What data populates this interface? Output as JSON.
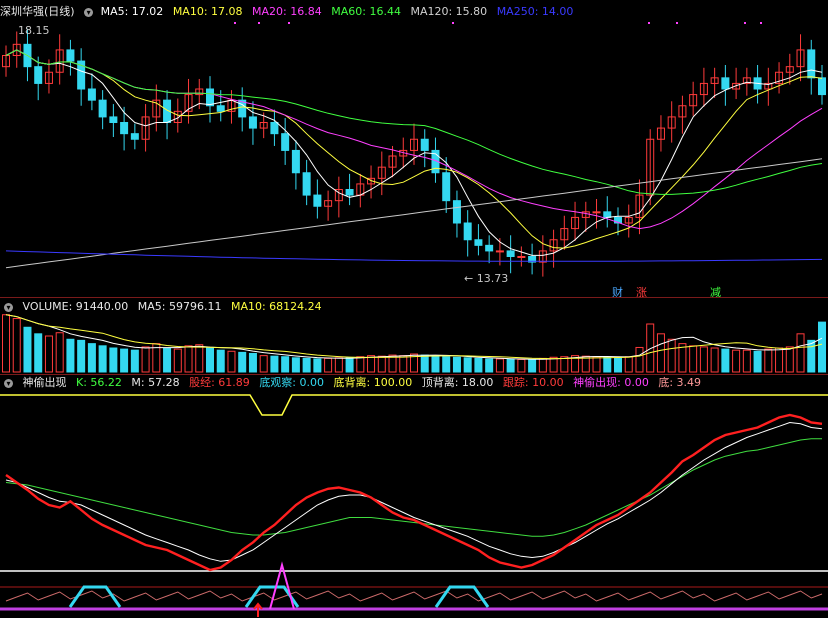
{
  "main_header": {
    "stock_title": "深圳华强(日线)",
    "ma5": "MA5: 17.02",
    "ma10": "MA10: 17.08",
    "ma20": "MA20: 16.84",
    "ma60": "MA60: 16.44",
    "ma120": "MA120: 15.80",
    "ma250": "MA250: 14.00"
  },
  "price_annotations": {
    "high_label": "18.15",
    "low_label": "13.73",
    "signal_cai": "财",
    "signal_zhang": "涨",
    "signal_jian": "减"
  },
  "volume_header": {
    "volume": "VOLUME: 91440.00",
    "ma5": "MA5: 59796.11",
    "ma10": "MA10: 68124.24"
  },
  "indicator_header": {
    "name": "神偷出现",
    "k": "K: 56.22",
    "m": "M: 57.28",
    "gujing": "股经: 61.89",
    "diguancha": "底观察: 0.00",
    "dibeili": "底背离: 100.00",
    "dingbeili": "顶背离: 18.00",
    "genzong": "跟踪: 10.00",
    "shentou": "神偷出现: 0.00",
    "di": "底: 3.49"
  },
  "colors": {
    "up": "#ff3b3b",
    "down": "#34d8f0",
    "ma5": "#ffffff",
    "ma10": "#ffff40",
    "ma20": "#ff40ff",
    "ma60": "#40ff40",
    "ma120": "#c8c8c8",
    "ma250": "#3a3aff"
  },
  "chart_data": {
    "type": "candlestick",
    "series": [
      {
        "name": "MA5",
        "last": 17.02
      },
      {
        "name": "MA10",
        "last": 17.08
      },
      {
        "name": "MA20",
        "last": 16.84
      },
      {
        "name": "MA60",
        "last": 16.44
      },
      {
        "name": "MA120",
        "last": 15.8
      },
      {
        "name": "MA250",
        "last": 14.0
      }
    ],
    "price_high": 18.15,
    "price_low": 13.73,
    "close": [
      17.7,
      17.9,
      17.5,
      17.2,
      17.4,
      17.8,
      17.6,
      17.1,
      16.9,
      16.6,
      16.5,
      16.3,
      16.2,
      16.6,
      16.9,
      16.5,
      16.7,
      17.0,
      17.1,
      16.8,
      16.7,
      16.9,
      16.6,
      16.4,
      16.5,
      16.3,
      16.0,
      15.6,
      15.2,
      15.0,
      15.1,
      15.3,
      15.2,
      15.4,
      15.5,
      15.7,
      15.9,
      16.0,
      16.2,
      16.0,
      15.6,
      15.1,
      14.7,
      14.4,
      14.3,
      14.2,
      14.2,
      14.1,
      14.1,
      14.0,
      14.2,
      14.4,
      14.6,
      14.8,
      14.9,
      14.9,
      14.8,
      14.7,
      14.8,
      15.2,
      16.2,
      16.4,
      16.6,
      16.8,
      17.0,
      17.2,
      17.3,
      17.1,
      17.2,
      17.3,
      17.1,
      17.2,
      17.4,
      17.5,
      17.8,
      17.3,
      17.0
    ],
    "volume": [
      105000,
      98000,
      82000,
      70000,
      66000,
      72000,
      60000,
      58000,
      52000,
      48000,
      44000,
      42000,
      40000,
      46000,
      52000,
      44000,
      42000,
      48000,
      50000,
      44000,
      40000,
      38000,
      36000,
      34000,
      30000,
      29000,
      28000,
      26000,
      25000,
      24000,
      25000,
      26000,
      26000,
      28000,
      30000,
      29000,
      31000,
      30000,
      33000,
      31000,
      30000,
      28000,
      27000,
      26000,
      25000,
      24000,
      24000,
      23000,
      23000,
      22000,
      25000,
      27000,
      28000,
      30000,
      29000,
      28000,
      27000,
      26000,
      28000,
      45000,
      88000,
      70000,
      60000,
      52000,
      48000,
      46000,
      44000,
      42000,
      40000,
      40000,
      38000,
      42000,
      44000,
      46000,
      70000,
      58000,
      91440
    ],
    "k_line": [
      84,
      78,
      72,
      65,
      60,
      58,
      63,
      56,
      49,
      44,
      40,
      36,
      32,
      28,
      26,
      24,
      20,
      16,
      12,
      8,
      10,
      16,
      24,
      30,
      38,
      44,
      52,
      60,
      66,
      70,
      73,
      74,
      72,
      70,
      66,
      60,
      54,
      50,
      48,
      44,
      40,
      36,
      32,
      28,
      24,
      18,
      14,
      12,
      10,
      12,
      16,
      20,
      26,
      32,
      38,
      44,
      48,
      52,
      58,
      64,
      70,
      78,
      86,
      95,
      100,
      106,
      112,
      116,
      118,
      120,
      122,
      126,
      130,
      132,
      130,
      126,
      125
    ],
    "m_line": [
      80,
      78,
      74,
      70,
      66,
      63,
      62,
      60,
      56,
      52,
      48,
      44,
      40,
      36,
      33,
      30,
      27,
      24,
      20,
      17,
      15,
      16,
      20,
      24,
      30,
      36,
      42,
      48,
      54,
      60,
      64,
      67,
      68,
      68,
      66,
      62,
      58,
      54,
      50,
      47,
      44,
      41,
      38,
      35,
      31,
      27,
      24,
      21,
      19,
      18,
      19,
      22,
      26,
      30,
      35,
      40,
      45,
      49,
      54,
      59,
      64,
      70,
      77,
      84,
      90,
      96,
      101,
      106,
      110,
      114,
      117,
      120,
      123,
      126,
      125,
      122,
      121
    ],
    "slow_line": [
      78,
      77,
      76,
      74,
      72,
      70,
      68,
      66,
      64,
      62,
      60,
      58,
      56,
      54,
      52,
      50,
      48,
      46,
      44,
      42,
      40,
      38,
      37,
      36,
      36,
      37,
      38,
      40,
      42,
      44,
      46,
      48,
      50,
      50,
      50,
      49,
      48,
      47,
      46,
      45,
      44,
      43,
      42,
      41,
      40,
      39,
      38,
      37,
      36,
      35,
      35,
      36,
      38,
      41,
      44,
      48,
      52,
      56,
      60,
      64,
      68,
      73,
      78,
      83,
      88,
      92,
      96,
      99,
      101,
      103,
      104,
      106,
      108,
      110,
      112,
      113,
      113
    ]
  }
}
